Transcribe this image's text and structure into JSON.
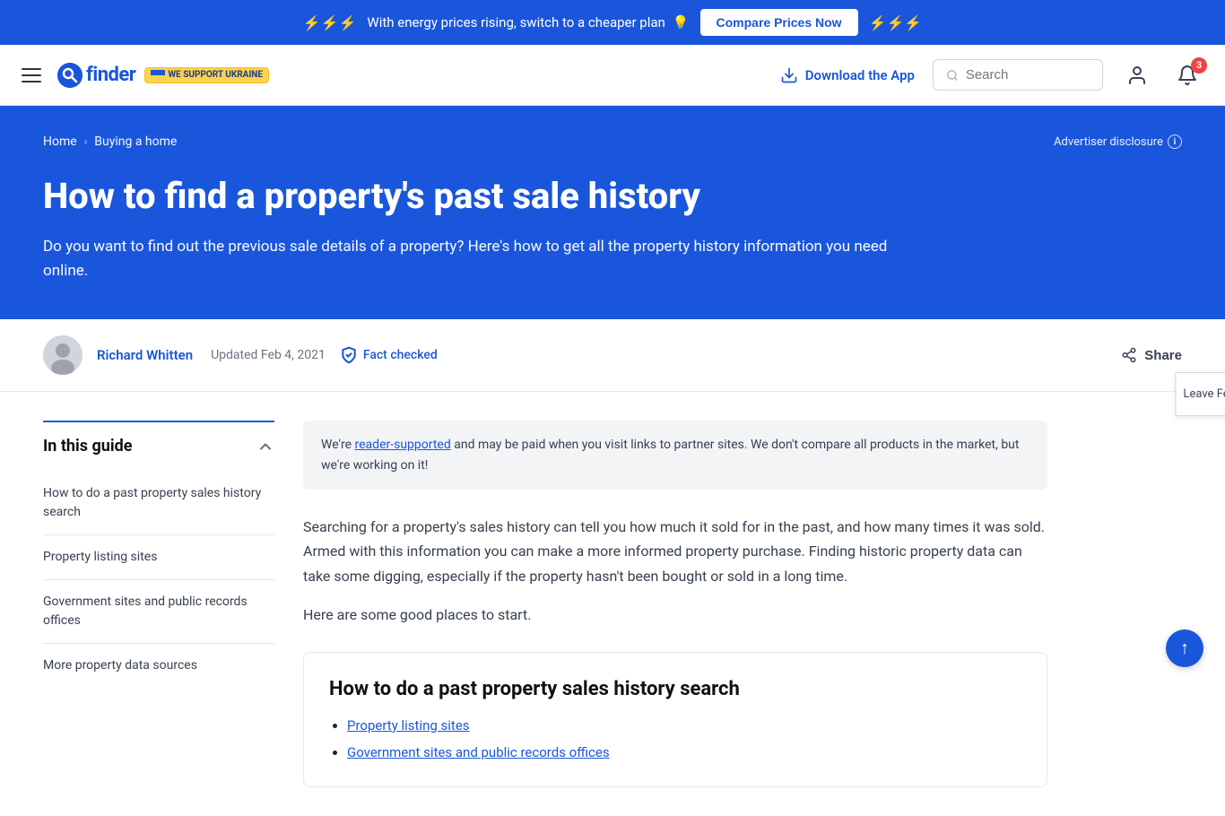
{
  "topBanner": {
    "lightning_emojis_left": "⚡⚡⚡",
    "text": "With energy prices rising, switch to a cheaper plan",
    "bulb_emoji": "💡",
    "cta_label": "Compare Prices Now",
    "lightning_emojis_right": "⚡⚡⚡"
  },
  "header": {
    "logo_letter": "f",
    "logo_name": "finder",
    "ukraine_text": "WE SUPPORT UKRAINE",
    "download_label": "Download the App",
    "search_placeholder": "Search",
    "notification_count": "3"
  },
  "hero": {
    "breadcrumb_home": "Home",
    "breadcrumb_section": "Buying a home",
    "advertiser_disclosure": "Advertiser disclosure",
    "h1": "How to find a property's past sale history",
    "subtitle": "Do you want to find out the previous sale details of a property? Here's how to get all the property history information you need online."
  },
  "articleMeta": {
    "author_name": "Richard Whitten",
    "updated_label": "Updated",
    "updated_date": "Feb 4, 2021",
    "fact_checked_label": "Fact checked",
    "share_label": "Share"
  },
  "sidebar": {
    "in_this_guide_label": "In this guide",
    "nav_items": [
      "How to do a past property sales history search",
      "Property listing sites",
      "Government sites and public records offices",
      "More property data sources"
    ]
  },
  "articleBody": {
    "disclaimer": {
      "prefix": "We're",
      "link_text": "reader-supported",
      "suffix": "and may be paid when you visit links to partner sites. We don't compare all products in the market, but we're working on it!"
    },
    "intro_1": "Searching for a property's sales history can tell you how much it sold for in the past, and how many times it was sold. Armed with this information you can make a more informed property purchase. Finding historic property data can take some digging, especially if the property hasn't been bought or sold in a long time.",
    "intro_2": "Here are some good places to start.",
    "section_box": {
      "h2": "How to do a past property sales history search",
      "list_items": [
        "Property listing sites",
        "Government sites and public records offices"
      ]
    }
  },
  "feedbackTab": {
    "label": "Leave Feedback"
  },
  "scrollTop": {
    "icon": "↑"
  }
}
